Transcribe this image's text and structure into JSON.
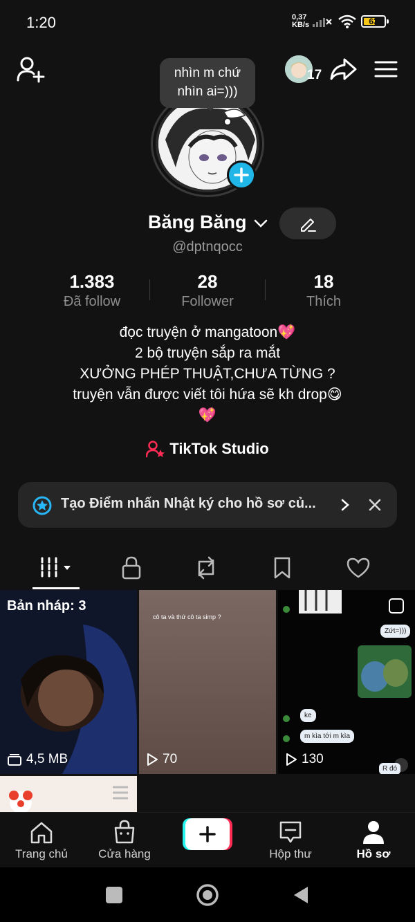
{
  "status": {
    "time": "1:20",
    "net_speed_value": "0,37",
    "net_speed_unit": "KB/s",
    "battery": "63",
    "battery_level": 0.63
  },
  "header": {
    "follower_count_badge": "17"
  },
  "bubble": {
    "line1": "nhìn m chứ",
    "line2": "nhìn ai=)))"
  },
  "profile": {
    "name": "Băng Băng",
    "handle": "@dptnqocc"
  },
  "stats": [
    {
      "value": "1.383",
      "label": "Đã follow"
    },
    {
      "value": "28",
      "label": "Follower"
    },
    {
      "value": "18",
      "label": "Thích"
    }
  ],
  "bio": {
    "line1": "đọc truyện ở mangatoon",
    "line2": "2 bộ truyện sắp ra mắt",
    "line3": "XƯỞNG PHÉP THUẬT,CHƯA TỪNG ?",
    "line4": "truyện vẫn được viết tôi hứa sẽ kh drop",
    "emoji_heart": "💖",
    "emoji_yum": "😋"
  },
  "studio": {
    "label": "TikTok Studio"
  },
  "banner": {
    "text": "Tạo Điểm nhấn Nhật ký cho hồ sơ củ..."
  },
  "grid": {
    "drafts_label": "Bản nháp: 3",
    "drafts_size": "4,5 MB",
    "video2_caption": "cô ta và thứ cô ta simp ?",
    "video2_views": "70",
    "video3_views": "130",
    "video3_chat": [
      "Zứt=)))",
      "ke",
      "m kìa tới m kìa",
      "R đó"
    ]
  },
  "bottom_nav": {
    "home": "Trang chủ",
    "shop": "Cửa hàng",
    "inbox": "Hộp thư",
    "profile": "Hồ sơ"
  },
  "colors": {
    "accent_cyan": "#20b7e8",
    "accent_red": "#fe2c55",
    "background": "#121212"
  }
}
